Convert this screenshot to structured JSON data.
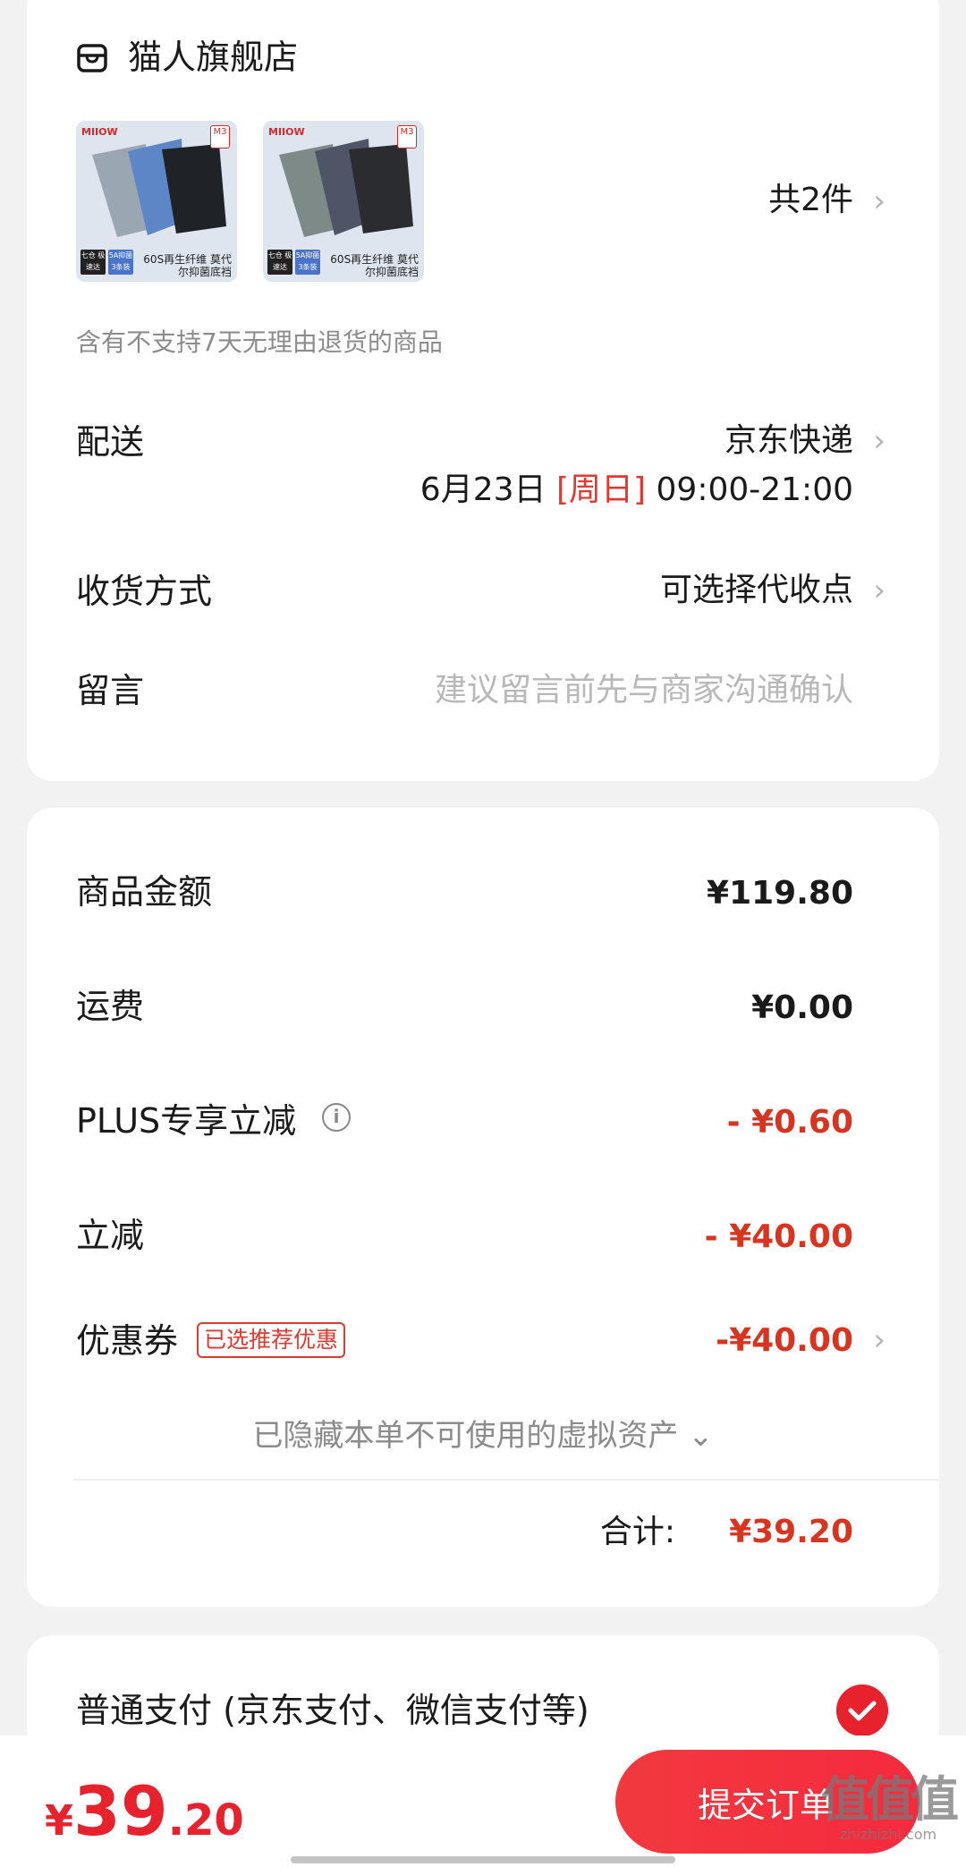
{
  "store": {
    "name": "猫人旗舰店",
    "items_count": "共2件",
    "return_notice": "含有不支持7天无理由退货的商品",
    "products": [
      {
        "logo": "MIIOW",
        "size_tag": "M3",
        "caption": "60S再生纤维 莫代尔抑菌底裆",
        "badge1": "七仓 极速达",
        "badge2": "5A抑菌 3条装"
      },
      {
        "logo": "MIIOW",
        "size_tag": "M3",
        "caption": "60S再生纤维 莫代尔抑菌底裆",
        "badge1": "七仓 极速达",
        "badge2": "5A抑菌 3条装"
      }
    ]
  },
  "delivery": {
    "label": "配送",
    "carrier": "京东快递",
    "date": "6月23日",
    "weekday": "[周日]",
    "time_window": "09:00-21:00"
  },
  "receive": {
    "label": "收货方式",
    "value": "可选择代收点"
  },
  "message": {
    "label": "留言",
    "placeholder": "建议留言前先与商家沟通确认"
  },
  "price": {
    "goods_label": "商品金额",
    "goods_value": "¥119.80",
    "shipping_label": "运费",
    "shipping_value": "¥0.00",
    "plus_label": "PLUS专享立减",
    "plus_value": "- ¥0.60",
    "discount_label": "立减",
    "discount_value": "- ¥40.00",
    "coupon_label": "优惠券",
    "coupon_tag": "已选推荐优惠",
    "coupon_value": "-¥40.00",
    "hidden_assets": "已隐藏本单不可使用的虚拟资产",
    "total_label": "合计:",
    "total_value": "¥39.20"
  },
  "payment": {
    "method": "普通支付 (京东支付、微信支付等)"
  },
  "bottom": {
    "yen": "¥",
    "amount_int": "39",
    "amount_dec": ".20",
    "submit": "提交订单"
  },
  "watermark": {
    "logo": "值值值",
    "url": "zhizhizhi.com"
  },
  "colors": {
    "accent_red": "#e8222c",
    "price_red": "#d9341f",
    "background": "#f2f2f2"
  }
}
